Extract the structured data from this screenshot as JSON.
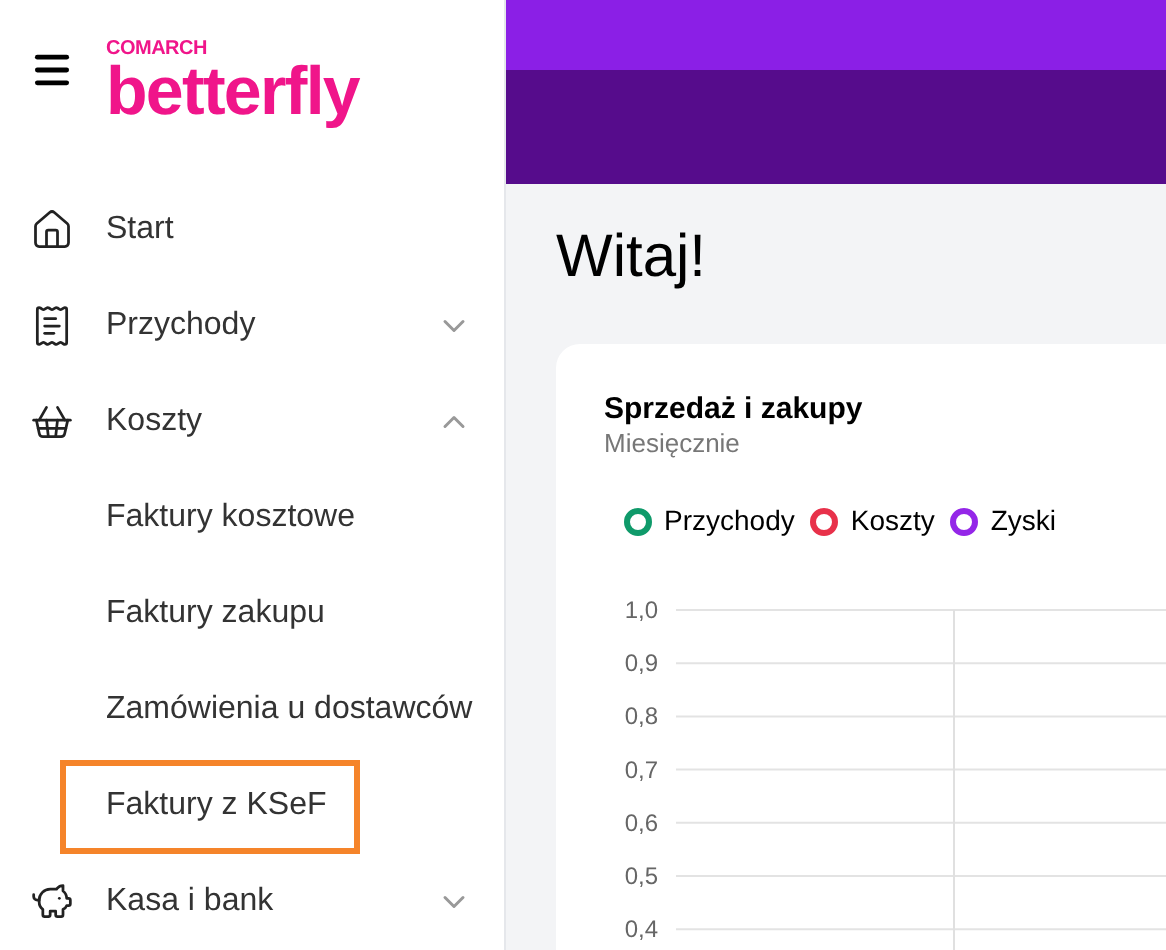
{
  "logo": {
    "brand": "COMARCH",
    "product": "betterfly"
  },
  "sidebar": {
    "items": [
      {
        "label": "Start"
      },
      {
        "label": "Przychody",
        "expanded": false
      },
      {
        "label": "Koszty",
        "expanded": true,
        "children": [
          {
            "label": "Faktury kosztowe",
            "highlighted": false
          },
          {
            "label": "Faktury zakupu",
            "highlighted": false
          },
          {
            "label": "Zamówienia u dostawców",
            "highlighted": false
          },
          {
            "label": "Faktury z KSeF",
            "highlighted": true
          }
        ]
      },
      {
        "label": "Kasa i bank",
        "expanded": false
      }
    ]
  },
  "main": {
    "heading": "Witaj!",
    "card": {
      "title": "Sprzedaż i zakupy",
      "subtitle": "Miesięcznie",
      "chart_data": {
        "type": "line",
        "categories": [
          null,
          null
        ],
        "series": [
          {
            "name": "Przychody",
            "color": "#0f9a6a",
            "values": [
              null,
              null
            ]
          },
          {
            "name": "Koszty",
            "color": "#e8314a",
            "values": [
              null,
              null
            ]
          },
          {
            "name": "Zyski",
            "color": "#9426e8",
            "values": [
              null,
              null
            ]
          }
        ],
        "grid": true,
        "ylim": [
          0.4,
          1.0
        ],
        "yticks": [
          {
            "value": 1.0,
            "label": "1,0"
          },
          {
            "value": 0.9,
            "label": "0,9"
          },
          {
            "value": 0.8,
            "label": "0,8"
          },
          {
            "value": 0.7,
            "label": "0,7"
          },
          {
            "value": 0.6,
            "label": "0,6"
          },
          {
            "value": 0.5,
            "label": "0,5"
          },
          {
            "value": 0.4,
            "label": "0,4"
          }
        ]
      }
    }
  }
}
